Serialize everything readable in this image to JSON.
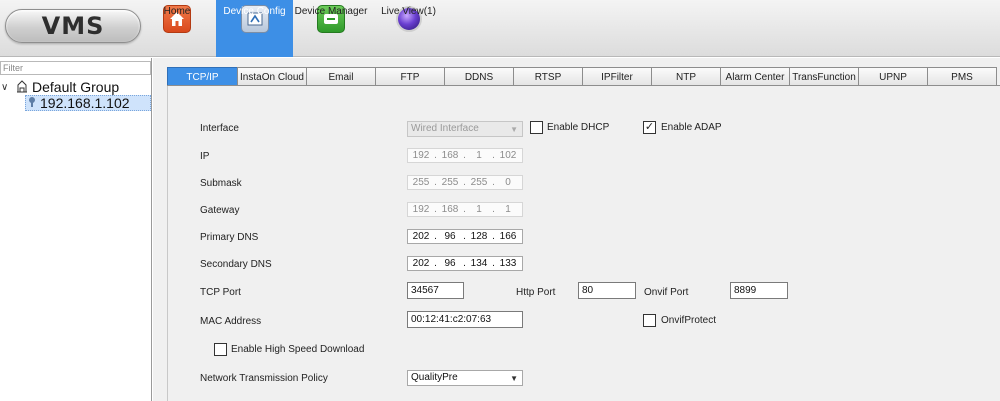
{
  "app": {
    "logo": "VMS"
  },
  "nav": [
    {
      "label": "Home",
      "icon": "home-icon"
    },
    {
      "label": "Device Config",
      "icon": "device-config-icon",
      "active": true
    },
    {
      "label": "Device Manager",
      "icon": "device-manager-icon"
    },
    {
      "label": "Live View(1)",
      "icon": "live-view-icon"
    }
  ],
  "sidebar": {
    "filter_placeholder": "Filter",
    "group_label": "Default Group",
    "device_label": "192.168.1.102"
  },
  "tabs": [
    "TCP/IP",
    "InstaOn Cloud",
    "Email",
    "FTP",
    "DDNS",
    "RTSP",
    "IPFilter",
    "NTP",
    "Alarm Center",
    "TransFunction",
    "UPNP",
    "PMS"
  ],
  "active_tab": "TCP/IP",
  "form": {
    "interface_label": "Interface",
    "interface_value": "Wired Interface",
    "enable_dhcp_label": "Enable DHCP",
    "enable_dhcp_checked": false,
    "enable_adap_label": "Enable ADAP",
    "enable_adap_checked": true,
    "ip_label": "IP",
    "ip": [
      "192",
      "168",
      "1",
      "102"
    ],
    "submask_label": "Submask",
    "submask": [
      "255",
      "255",
      "255",
      "0"
    ],
    "gateway_label": "Gateway",
    "gateway": [
      "192",
      "168",
      "1",
      "1"
    ],
    "primary_dns_label": "Primary DNS",
    "primary_dns": [
      "202",
      "96",
      "128",
      "166"
    ],
    "secondary_dns_label": "Secondary DNS",
    "secondary_dns": [
      "202",
      "96",
      "134",
      "133"
    ],
    "tcp_port_label": "TCP Port",
    "tcp_port": "34567",
    "http_port_label": "Http Port",
    "http_port": "80",
    "onvif_port_label": "Onvif Port",
    "onvif_port": "8899",
    "mac_label": "MAC Address",
    "mac": "00:12:41:c2:07:63",
    "onvif_protect_label": "OnvifProtect",
    "onvif_protect_checked": false,
    "high_speed_label": "Enable High Speed Download",
    "high_speed_checked": false,
    "policy_label": "Network Transmission Policy",
    "policy_value": "QualityPre"
  },
  "colors": {
    "accent": "#3d8fe6",
    "selection": "#cfe3fb"
  }
}
